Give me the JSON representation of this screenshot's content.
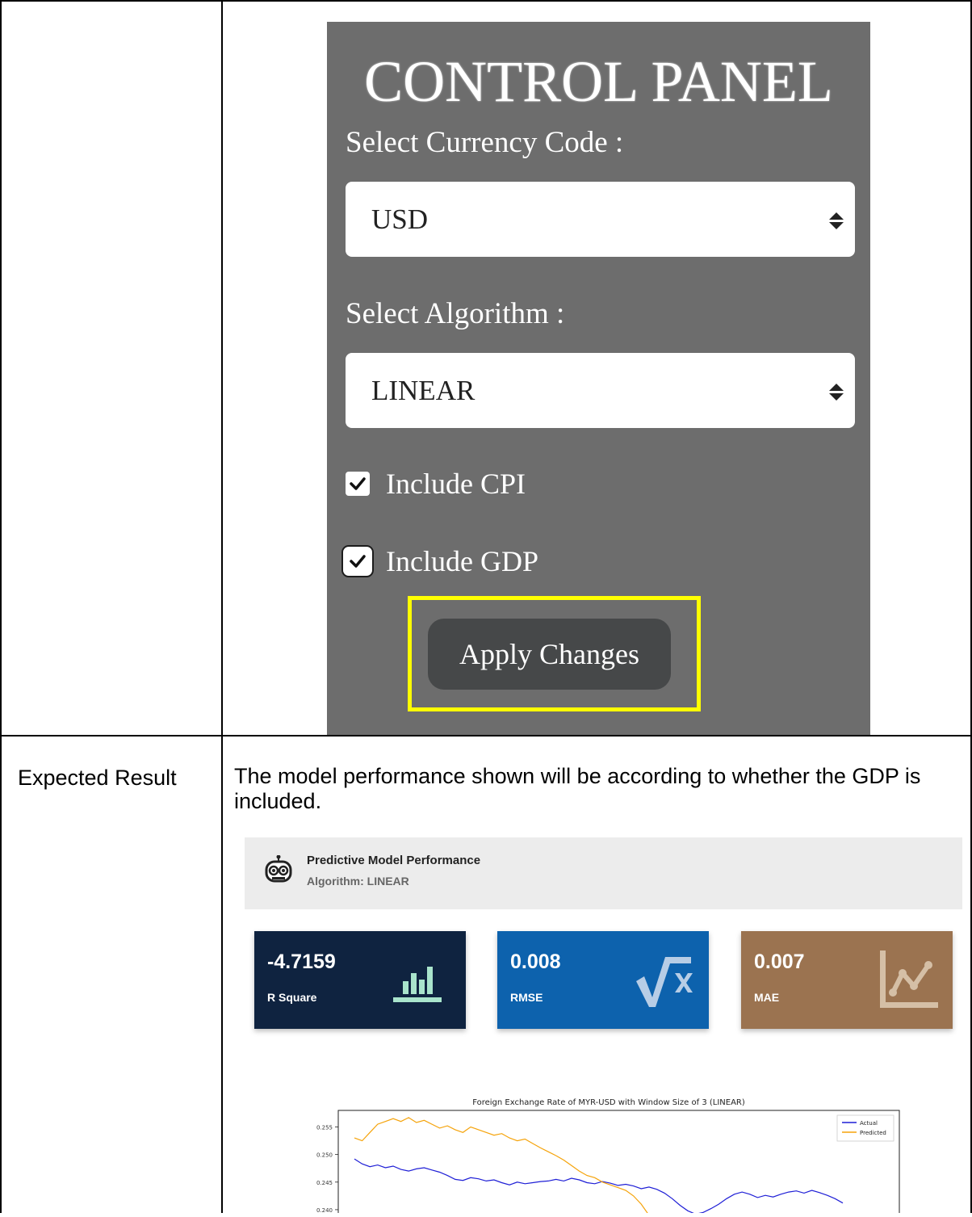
{
  "control_panel": {
    "title": "CONTROL PANEL",
    "currency_label": "Select Currency Code :",
    "currency_value": "USD",
    "algorithm_label": "Select Algorithm :",
    "algorithm_value": "LINEAR",
    "include_cpi_label": "Include CPI",
    "include_cpi_checked": true,
    "include_gdp_label": "Include GDP",
    "include_gdp_checked": true,
    "apply_button": "Apply Changes",
    "highlight_color": "#ffff00"
  },
  "row": {
    "label": "Expected Result",
    "description": "The model performance shown will be according to whether the GDP is included."
  },
  "dashboard": {
    "title": "Predictive Model Performance",
    "subtitle": "Algorithm: LINEAR",
    "metrics": [
      {
        "value": "-4.7159",
        "label": "R Square",
        "color": "#0f2340",
        "icon": "bar-chart-icon",
        "icon_color": "#a9e4cc"
      },
      {
        "value": "0.008",
        "label": "RMSE",
        "color": "#0d62ad",
        "icon": "square-root-icon",
        "icon_color": "#b7cde6"
      },
      {
        "value": "0.007",
        "label": "MAE",
        "color": "#9b7350",
        "icon": "line-chart-icon",
        "icon_color": "#d5bfa6"
      }
    ]
  },
  "chart_data": {
    "type": "line",
    "title": "Foreign Exchange Rate of MYR-USD with Window Size of 3 (LINEAR)",
    "xlabel": "",
    "ylabel": "",
    "yticks": [
      "0.255",
      "0.250",
      "0.245",
      "0.240"
    ],
    "ylim": [
      0.2375,
      0.258
    ],
    "legend_position": "top-right",
    "series": [
      {
        "name": "Actual",
        "color": "#1f1fd6",
        "values": [
          0.2492,
          0.2483,
          0.2478,
          0.2481,
          0.2476,
          0.2479,
          0.2473,
          0.247,
          0.2474,
          0.2476,
          0.2472,
          0.2468,
          0.2462,
          0.2455,
          0.2453,
          0.2458,
          0.2456,
          0.2452,
          0.2454,
          0.2449,
          0.2445,
          0.245,
          0.2447,
          0.2449,
          0.2451,
          0.2452,
          0.2455,
          0.2452,
          0.2457,
          0.2454,
          0.2449,
          0.2447,
          0.2451,
          0.2448,
          0.2444,
          0.2446,
          0.2443,
          0.2438,
          0.2441,
          0.2437,
          0.243,
          0.242,
          0.2408,
          0.2398,
          0.2392,
          0.2395,
          0.2402,
          0.241,
          0.242,
          0.2428,
          0.2432,
          0.2428,
          0.2422,
          0.2426,
          0.2423,
          0.2428,
          0.2432,
          0.2434,
          0.243,
          0.2435,
          0.2431,
          0.2426,
          0.242,
          0.2412
        ]
      },
      {
        "name": "Predicted",
        "color": "#f5a30a",
        "values": [
          0.253,
          0.2525,
          0.254,
          0.2555,
          0.256,
          0.2565,
          0.256,
          0.2567,
          0.2558,
          0.2562,
          0.2555,
          0.2548,
          0.2552,
          0.2545,
          0.254,
          0.255,
          0.2545,
          0.254,
          0.2535,
          0.2538,
          0.253,
          0.2525,
          0.2528,
          0.252,
          0.2512,
          0.2505,
          0.2498,
          0.249,
          0.248,
          0.247,
          0.2462,
          0.2458,
          0.245,
          0.2445,
          0.244,
          0.2435,
          0.2425,
          0.241,
          0.239
        ]
      }
    ]
  }
}
